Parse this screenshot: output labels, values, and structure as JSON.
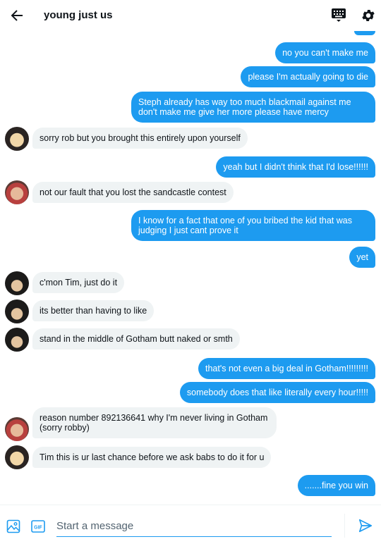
{
  "header": {
    "title": "young just us",
    "back_icon": "arrow-left-icon",
    "keyboard_icon": "keyboard-icon",
    "settings_icon": "gear-icon"
  },
  "colors": {
    "accent": "#1d9bf0",
    "incoming_bg": "#eff3f4"
  },
  "messages": [
    {
      "dir": "out",
      "text": "no you can't make me"
    },
    {
      "dir": "out",
      "text": "please I'm actually going to die"
    },
    {
      "dir": "out",
      "text": "Steph already has way too much blackmail against me\ndon't make me give her more please have mercy"
    },
    {
      "dir": "in",
      "text": "sorry rob but you brought this entirely upon yourself"
    },
    {
      "dir": "out",
      "text": "yeah but I didn't think that I'd lose!!!!!!"
    },
    {
      "dir": "in",
      "text": "not our fault that you lost the sandcastle contest"
    },
    {
      "dir": "out",
      "text": "I know for a fact that one of you bribed the kid that was\njudging I just cant prove it"
    },
    {
      "dir": "out",
      "text": "yet"
    },
    {
      "dir": "in",
      "text": "c'mon Tim, just do it"
    },
    {
      "dir": "in",
      "text": "its better than having to like"
    },
    {
      "dir": "in",
      "text": "stand in the middle of Gotham butt naked or smth"
    },
    {
      "dir": "out",
      "text": "that's not even a big deal in Gotham!!!!!!!!!"
    },
    {
      "dir": "out",
      "text": "somebody does that like literally every hour!!!!!"
    },
    {
      "dir": "in",
      "text": "reason number 892136641 why I'm never living in Gotham\n(sorry robby)"
    },
    {
      "dir": "in",
      "text": "Tim this is ur last chance before we ask babs to do it for u"
    },
    {
      "dir": "out",
      "text": ".......fine you win"
    }
  ],
  "composer": {
    "placeholder": "Start a message",
    "gif_label": "GIF",
    "image_icon": "image-icon",
    "send_icon": "send-icon"
  }
}
